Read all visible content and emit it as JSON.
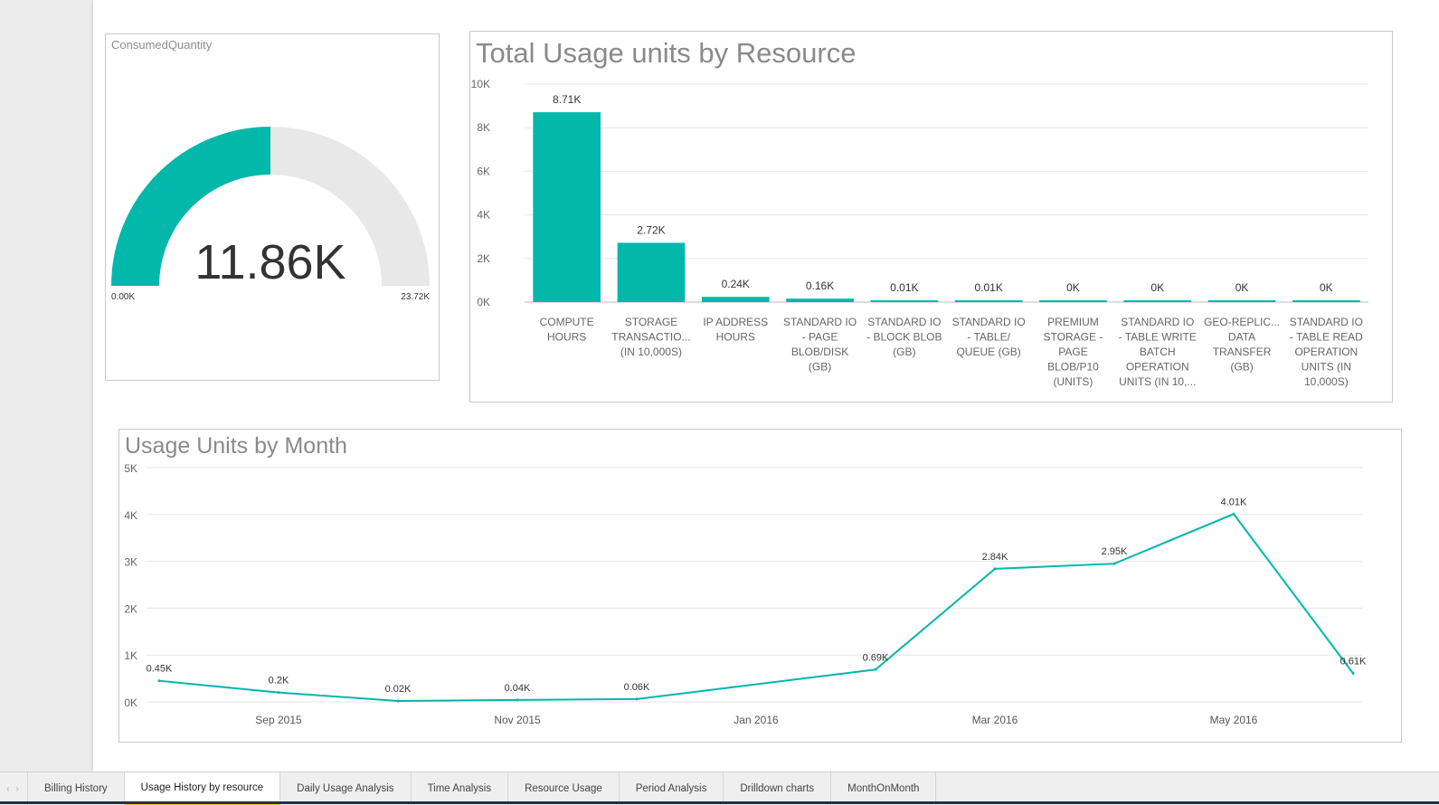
{
  "colors": {
    "accent": "#01b8aa",
    "gauge_track": "#e8e8e8",
    "active_tab_marker": "#f2c811"
  },
  "gauge": {
    "title": "ConsumedQuantity",
    "value_label": "11.86K",
    "min_label": "0.00K",
    "max_label": "23.72K",
    "value": 11.86,
    "max": 23.72
  },
  "chart_data": [
    {
      "type": "bar",
      "title": "Total Usage units by Resource",
      "y_ticks": [
        "10K",
        "8K",
        "6K",
        "4K",
        "2K",
        "0K"
      ],
      "ylim": [
        0,
        10000
      ],
      "grid": true,
      "categories": [
        [
          "COMPUTE",
          "HOURS"
        ],
        [
          "STORAGE",
          "TRANSACTIO...",
          "(IN 10,000S)"
        ],
        [
          "IP ADDRESS",
          "HOURS"
        ],
        [
          "STANDARD IO",
          "- PAGE",
          "BLOB/DISK",
          "(GB)"
        ],
        [
          "STANDARD IO",
          "- BLOCK BLOB",
          "(GB)"
        ],
        [
          "STANDARD IO",
          "- TABLE/",
          "QUEUE (GB)"
        ],
        [
          "PREMIUM",
          "STORAGE -",
          "PAGE",
          "BLOB/P10",
          "(UNITS)"
        ],
        [
          "STANDARD IO",
          "- TABLE WRITE",
          "BATCH",
          "OPERATION",
          "UNITS (IN 10,..."
        ],
        [
          "GEO-REPLIC...",
          "DATA",
          "TRANSFER",
          "(GB)"
        ],
        [
          "STANDARD IO",
          "- TABLE READ",
          "OPERATION",
          "UNITS (IN",
          "10,000S)"
        ]
      ],
      "values": [
        8710,
        2720,
        240,
        160,
        10,
        10,
        0,
        0,
        0,
        0
      ],
      "data_labels": [
        "8.71K",
        "2.72K",
        "0.24K",
        "0.16K",
        "0.01K",
        "0.01K",
        "0K",
        "0K",
        "0K",
        "0K"
      ]
    },
    {
      "type": "line",
      "title": "Usage Units by Month",
      "y_ticks": [
        "5K",
        "4K",
        "3K",
        "2K",
        "1K",
        "0K"
      ],
      "ylim": [
        0,
        5000
      ],
      "grid": true,
      "x": [
        "2015-08",
        "2015-09",
        "2015-10",
        "2015-11",
        "2015-12",
        "2016-01",
        "2016-02",
        "2016-03",
        "2016-04",
        "2016-05",
        "2016-06"
      ],
      "x_tick_labels": [
        {
          "x": "2015-09",
          "label": "Sep 2015"
        },
        {
          "x": "2015-11",
          "label": "Nov 2015"
        },
        {
          "x": "2016-01",
          "label": "Jan 2016"
        },
        {
          "x": "2016-03",
          "label": "Mar 2016"
        },
        {
          "x": "2016-05",
          "label": "May 2016"
        }
      ],
      "values": [
        450,
        200,
        20,
        40,
        60,
        null,
        690,
        2840,
        2950,
        4010,
        610
      ],
      "data_labels": [
        "0.45K",
        "0.2K",
        "0.02K",
        "0.04K",
        "0.06K",
        "",
        "0.69K",
        "2.84K",
        "2.95K",
        "4.01K",
        "0.61K"
      ]
    }
  ],
  "tabs": [
    {
      "label": "Billing History",
      "active": false
    },
    {
      "label": "Usage History by resource",
      "active": true
    },
    {
      "label": "Daily Usage Analysis",
      "active": false
    },
    {
      "label": "Time Analysis",
      "active": false
    },
    {
      "label": "Resource Usage",
      "active": false
    },
    {
      "label": "Period Analysis",
      "active": false
    },
    {
      "label": "Drilldown charts",
      "active": false
    },
    {
      "label": "MonthOnMonth",
      "active": false
    }
  ]
}
